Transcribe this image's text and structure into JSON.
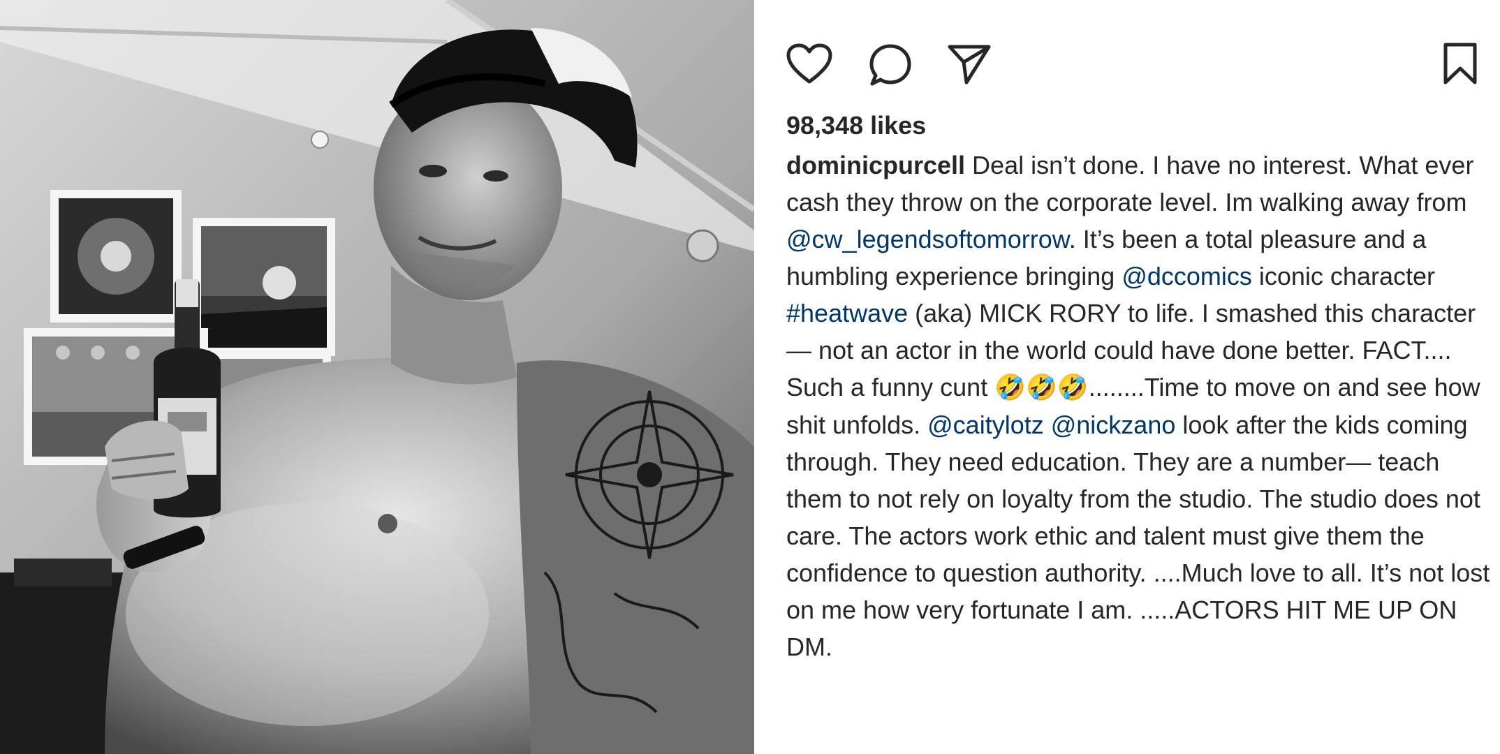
{
  "post": {
    "likes": "98,348 likes",
    "username": "dominicpurcell",
    "caption": {
      "t1": " Deal isn’t done. I have no interest. What ever cash they throw on the corporate level. Im walking away from ",
      "m1": "@cw_legendsoftomorrow",
      "t2": ". It’s been a total pleasure and a humbling experience bringing ",
      "m2": "@dccomics",
      "t3": " iconic character ",
      "h1": "#heatwave",
      "t4": " (aka) MICK RORY to life. I smashed this character— not an actor in the world could have done better. FACT.... Such a funny cunt ",
      "e1": "🤣🤣🤣",
      "t5": "........Time to move on and see how shit unfolds. ",
      "m3": "@caitylotz",
      "t6": " ",
      "m4": "@nickzano",
      "t7": " look after the kids coming through. They need education. They are a number—  teach them to not rely on loyalty from the studio. The studio does not care. The actors work ethic and talent must give them the confidence to question authority. ....Much love to all. It’s not lost on me how very fortunate I am. .....ACTORS HIT ME UP ON DM."
    }
  },
  "icons": {
    "like": "heart-icon",
    "comment": "comment-bubble-icon",
    "share": "paper-plane-icon",
    "save": "bookmark-icon"
  },
  "colors": {
    "text": "#262626",
    "link": "#00376b",
    "background": "#ffffff"
  }
}
